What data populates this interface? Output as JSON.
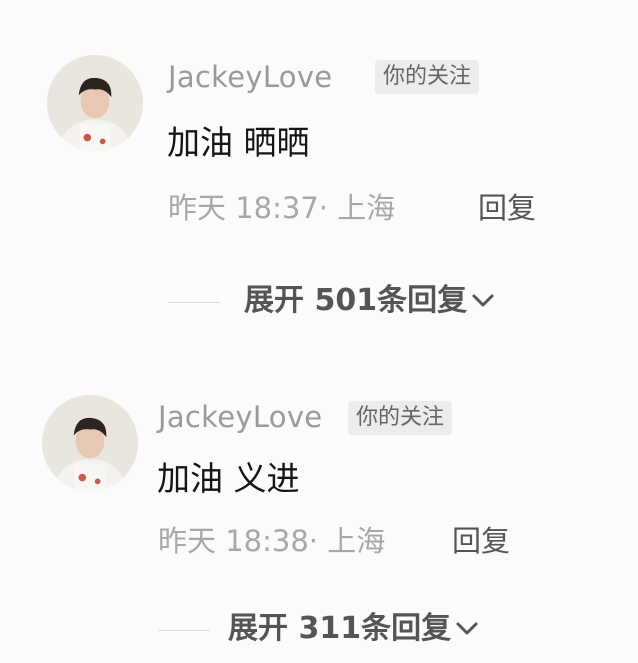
{
  "comments": [
    {
      "username": "JackeyLove",
      "badge": "你的关注",
      "text": "加油 晒晒",
      "meta": "昨天 18:37· 上海",
      "reply_label": "回复",
      "expand_label": "展开 501条回复"
    },
    {
      "username": "JackeyLove",
      "badge": "你的关注",
      "text": "加油 义进",
      "meta": "昨天 18:38· 上海",
      "reply_label": "回复",
      "expand_label": "展开 311条回复"
    }
  ],
  "icons": {
    "avatar": "avatar-photo",
    "expand": "chevron-down-icon"
  },
  "colors": {
    "background": "#fbfbfb",
    "username": "#9a9a9a",
    "badge_bg": "#ececec",
    "meta": "#a8a8a8"
  }
}
